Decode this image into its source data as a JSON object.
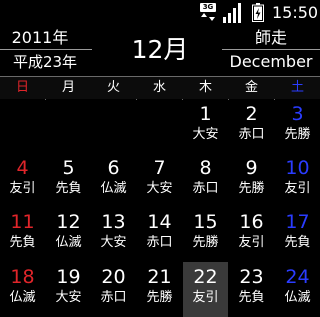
{
  "status": {
    "network_badge": "3G",
    "signal_icon": "signal-icon",
    "battery_icon": "battery-icon",
    "time": "15:50"
  },
  "header": {
    "year": "2011年",
    "era_year": "平成23年",
    "month": "12月",
    "old_month": "師走",
    "english_month": "December"
  },
  "weekdays": [
    "日",
    "月",
    "火",
    "水",
    "木",
    "金",
    "土"
  ],
  "colors": {
    "sunday": "#e0252a",
    "saturday": "#2a3cff",
    "today_bg": "#3a3a3a"
  },
  "weeks": [
    [
      {
        "day": "",
        "rokuyo": ""
      },
      {
        "day": "",
        "rokuyo": ""
      },
      {
        "day": "",
        "rokuyo": ""
      },
      {
        "day": "",
        "rokuyo": ""
      },
      {
        "day": "1",
        "rokuyo": "大安"
      },
      {
        "day": "2",
        "rokuyo": "赤口"
      },
      {
        "day": "3",
        "rokuyo": "先勝"
      }
    ],
    [
      {
        "day": "4",
        "rokuyo": "友引"
      },
      {
        "day": "5",
        "rokuyo": "先負"
      },
      {
        "day": "6",
        "rokuyo": "仏滅"
      },
      {
        "day": "7",
        "rokuyo": "大安"
      },
      {
        "day": "8",
        "rokuyo": "赤口"
      },
      {
        "day": "9",
        "rokuyo": "先勝"
      },
      {
        "day": "10",
        "rokuyo": "友引"
      }
    ],
    [
      {
        "day": "11",
        "rokuyo": "先負"
      },
      {
        "day": "12",
        "rokuyo": "仏滅"
      },
      {
        "day": "13",
        "rokuyo": "大安"
      },
      {
        "day": "14",
        "rokuyo": "赤口"
      },
      {
        "day": "15",
        "rokuyo": "先勝"
      },
      {
        "day": "16",
        "rokuyo": "友引"
      },
      {
        "day": "17",
        "rokuyo": "先負"
      }
    ],
    [
      {
        "day": "18",
        "rokuyo": "仏滅"
      },
      {
        "day": "19",
        "rokuyo": "大安"
      },
      {
        "day": "20",
        "rokuyo": "赤口"
      },
      {
        "day": "21",
        "rokuyo": "先勝"
      },
      {
        "day": "22",
        "rokuyo": "友引",
        "today": true
      },
      {
        "day": "23",
        "rokuyo": "先負"
      },
      {
        "day": "24",
        "rokuyo": "仏滅"
      }
    ]
  ]
}
